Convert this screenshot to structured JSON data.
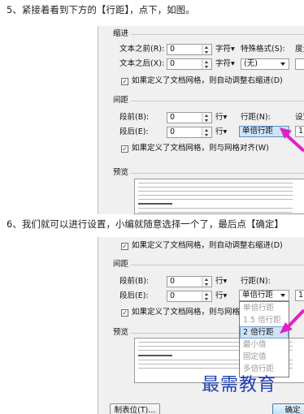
{
  "steps": {
    "step5": "5、紧接着看到下方的【行距】，点下，如图。",
    "step6": "6、我们就可以进行设置，小编就随意选择一个了，最后点【确定】"
  },
  "shot1": {
    "indent_section": "缩进",
    "before_text_label": "文本之前(R):",
    "before_text_value": "0",
    "after_text_label": "文本之后(X):",
    "after_text_value": "0",
    "unit_char": "字符▾",
    "special_format_label": "特殊格式(S):",
    "special_format_value": "(无)",
    "degree_label": "度量",
    "indent_grid_checkbox": "如果定义了文档网格，则自动调整右缩进(D)",
    "spacing_section": "间距",
    "before_para_label": "段前(B):",
    "before_para_value": "0",
    "after_para_label": "段后(E):",
    "after_para_value": "0",
    "unit_line": "行▾",
    "line_spacing_label": "行距(N):",
    "line_spacing_value": "单倍行距",
    "setting_label": "设置",
    "setting_value": "1",
    "snap_grid_checkbox": "如果定义了文档网格，则与网格对齐(W)",
    "preview_section": "预览"
  },
  "shot2": {
    "indent_grid_checkbox": "如果定义了文档网格，则自动调整右缩进(D)",
    "spacing_section": "间距",
    "before_para_label": "段前(B):",
    "before_para_value": "0",
    "after_para_label": "段后(E):",
    "after_para_value": "0",
    "unit_line": "行▾",
    "line_spacing_label": "行距(N):",
    "line_spacing_value": "单倍行距",
    "setting_value": "1",
    "snap_grid_checkbox": "如果定义了文档网格，则与网格对",
    "preview_section": "预览",
    "dropdown_options": [
      {
        "label": "单倍行距",
        "state": "dim"
      },
      {
        "label": "1.5 倍行距",
        "state": "dim"
      },
      {
        "label": "2 倍行距",
        "state": "selected"
      },
      {
        "label": "最小值",
        "state": "dim"
      },
      {
        "label": "固定值",
        "state": "dim"
      },
      {
        "label": "多倍行距",
        "state": "dim"
      }
    ],
    "tabs_button": "制表位(T)...",
    "ok_button": "确定"
  },
  "watermark": "最需教育",
  "colors": {
    "arrow": "#e020c8",
    "highlight": "#cfe4f7",
    "watermark": "#1e3fb0"
  }
}
